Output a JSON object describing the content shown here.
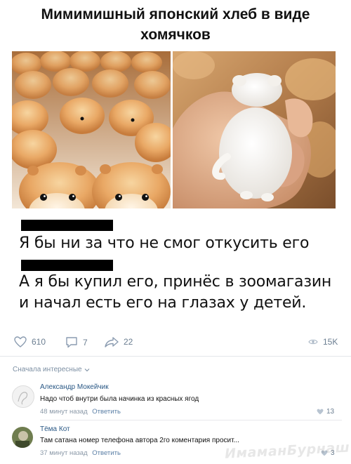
{
  "post": {
    "title_line1": "Мимимишный японский хлеб в виде",
    "title_line2": "хомячков"
  },
  "comments_image": {
    "comment1": "Я бы ни за что не смог откусить его",
    "comment2": "А я бы купил его, принёс в зоомагазин и начал есть его на глазах у детей."
  },
  "stats": {
    "likes": "610",
    "comments": "7",
    "reposts": "22",
    "views": "15K"
  },
  "sort": {
    "label": "Сначала интересные"
  },
  "comments": [
    {
      "author": "Александр Мокейчик",
      "text": "Надо чтоб внутри была начинка из красных ягод",
      "time": "48 минут назад",
      "reply": "Ответить",
      "likes": "13"
    },
    {
      "author": "Тёма Кот",
      "text": "Там сатана номер телефона автора 2го коментария просит...",
      "time": "37 минут назад",
      "reply": "Ответить",
      "likes": "3"
    }
  ],
  "watermark": "ИмаманБурнаш dns.ru",
  "colors": {
    "link": "#2a5885",
    "muted": "#6b7e91",
    "redaction": "#000000"
  }
}
